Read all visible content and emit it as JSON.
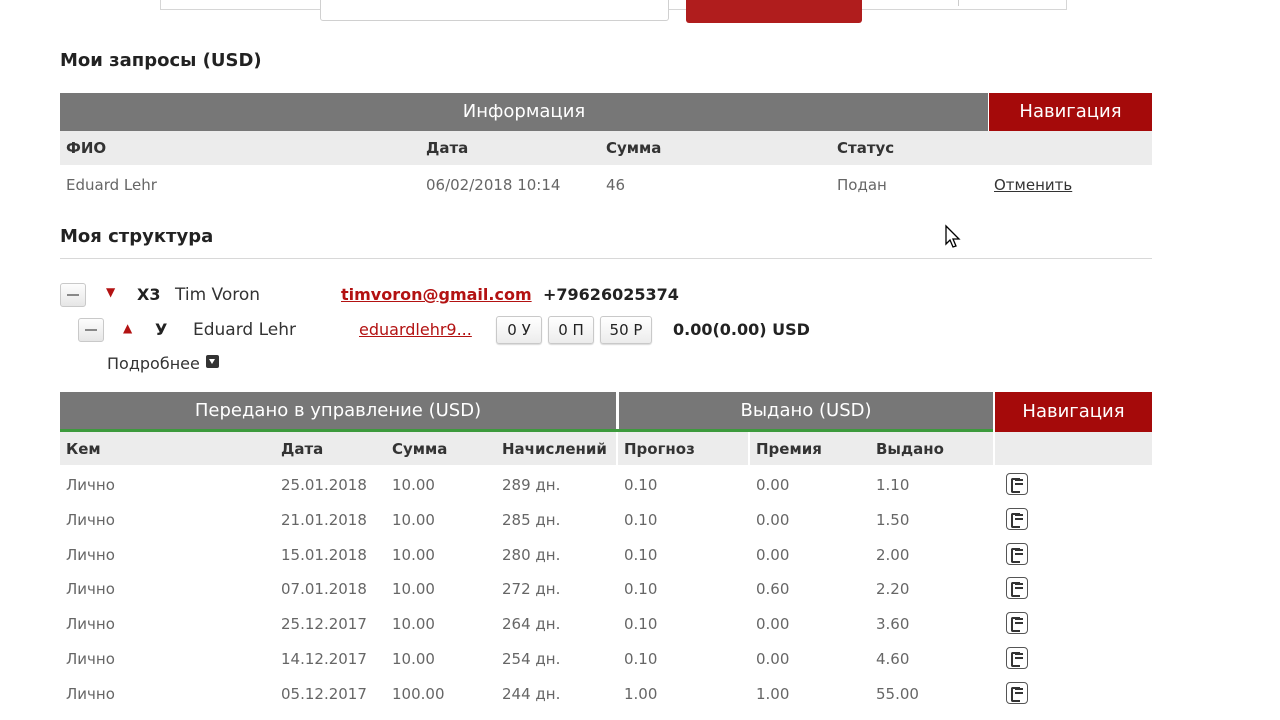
{
  "requests": {
    "title": "Мои запросы (USD)",
    "header_info": "Информация",
    "header_nav": "Навигация",
    "columns": [
      "ФИО",
      "Дата",
      "Сумма",
      "Статус"
    ],
    "row": {
      "name": "Eduard Lehr",
      "date": "06/02/2018 10:14",
      "amount": "46",
      "status": "Подан",
      "action": "Отменить"
    }
  },
  "structure": {
    "title": "Моя структура",
    "parent": {
      "level": "Х3",
      "name": "Tim Voron",
      "email": "timvoron@gmail.com",
      "phone": "+79626025374"
    },
    "child": {
      "level": "У",
      "name": "Eduard Lehr",
      "email": "eduardlehr9...",
      "pill1": "0 У",
      "pill2": "0 П",
      "pill3": "50 Р",
      "balance": "0.00(0.00) USD"
    },
    "more": "Подробнее"
  },
  "deposits": {
    "header_managed": "Передано в управление (USD)",
    "header_issued": "Выдано (USD)",
    "header_nav": "Навигация",
    "columns": [
      "Кем",
      "Дата",
      "Сумма",
      "Начислений",
      "Прогноз",
      "Премия",
      "Выдано"
    ],
    "rows": [
      [
        "Лично",
        "25.01.2018",
        "10.00",
        "289 дн.",
        "0.10",
        "0.00",
        "1.10"
      ],
      [
        "Лично",
        "21.01.2018",
        "10.00",
        "285 дн.",
        "0.10",
        "0.00",
        "1.50"
      ],
      [
        "Лично",
        "15.01.2018",
        "10.00",
        "280 дн.",
        "0.10",
        "0.00",
        "2.00"
      ],
      [
        "Лично",
        "07.01.2018",
        "10.00",
        "272 дн.",
        "0.10",
        "0.60",
        "2.20"
      ],
      [
        "Лично",
        "25.12.2017",
        "10.00",
        "264 дн.",
        "0.10",
        "0.00",
        "3.60"
      ],
      [
        "Лично",
        "14.12.2017",
        "10.00",
        "254 дн.",
        "0.10",
        "0.00",
        "4.60"
      ],
      [
        "Лично",
        "05.12.2017",
        "100.00",
        "244 дн.",
        "1.00",
        "1.00",
        "55.00"
      ]
    ]
  },
  "colors": {
    "accent_red": "#a50a0a",
    "header_gray": "#777777",
    "progress_green": "#3c9a3c"
  }
}
